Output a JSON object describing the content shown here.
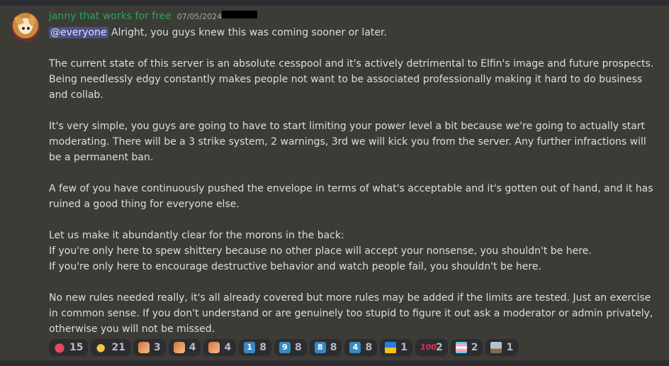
{
  "message": {
    "username": "janny that works for free",
    "timestamp": "07/05/2024",
    "mention": "@everyone",
    "paragraphs": [
      " Alright, you guys knew this was coming sooner or later.",
      "The current state of this server is an absolute cesspool and it's actively detrimental to Elfin's image and future prospects.",
      "Being needlessly edgy constantly makes people not want to be associated professionally making it hard to do business",
      "and collab.",
      "It's very simple, you guys are going to have to start limiting your power level a bit because we're going to actually start",
      "moderating. There will be a 3 strike system, 2 warnings, 3rd we will kick you from the server. Any further infractions will",
      "be a permanent ban.",
      "A few of you have continuously pushed the envelope in terms of what's acceptable and it's gotten out of hand, and it has",
      "ruined a good thing for everyone else.",
      "Let us make it abundantly clear for the morons in the back:",
      "If you're only here to spew shittery because no other place will accept your nonsense, you shouldn't be here.",
      "If you're only here to encourage destructive behavior and watch people fail, you shouldn't be here.",
      "No new rules needed really, it's all already covered but more rules may be added if the limits are tested. Just an exercise",
      "in common sense. If you don't understand or are genuinely too stupid to figure it out ask a moderator or admin privately,",
      "otherwise you will not be missed."
    ]
  },
  "reactions": [
    {
      "icon": "heart-icon",
      "count": "15"
    },
    {
      "icon": "chick-icon",
      "count": "21"
    },
    {
      "icon": "cat-emote-icon",
      "count": "3"
    },
    {
      "icon": "cat-emote-icon",
      "count": "4"
    },
    {
      "icon": "cat-emote-icon",
      "count": "4"
    },
    {
      "icon": "keycap-1-icon",
      "key": "1",
      "count": "8"
    },
    {
      "icon": "keycap-9-icon",
      "key": "9",
      "count": "8"
    },
    {
      "icon": "keycap-8-icon",
      "key": "8",
      "count": "8"
    },
    {
      "icon": "keycap-4-icon",
      "key": "4",
      "count": "8"
    },
    {
      "icon": "flag-icon",
      "count": "1"
    },
    {
      "icon": "hundred-icon",
      "label": "100",
      "count": "2"
    },
    {
      "icon": "trans-flag-icon",
      "count": "2"
    },
    {
      "icon": "school-icon",
      "count": "1"
    }
  ],
  "colors": {
    "background": "#3d3b36",
    "username": "#2aa661",
    "text": "#dbdee1",
    "mention_bg": "#4b4f87"
  }
}
